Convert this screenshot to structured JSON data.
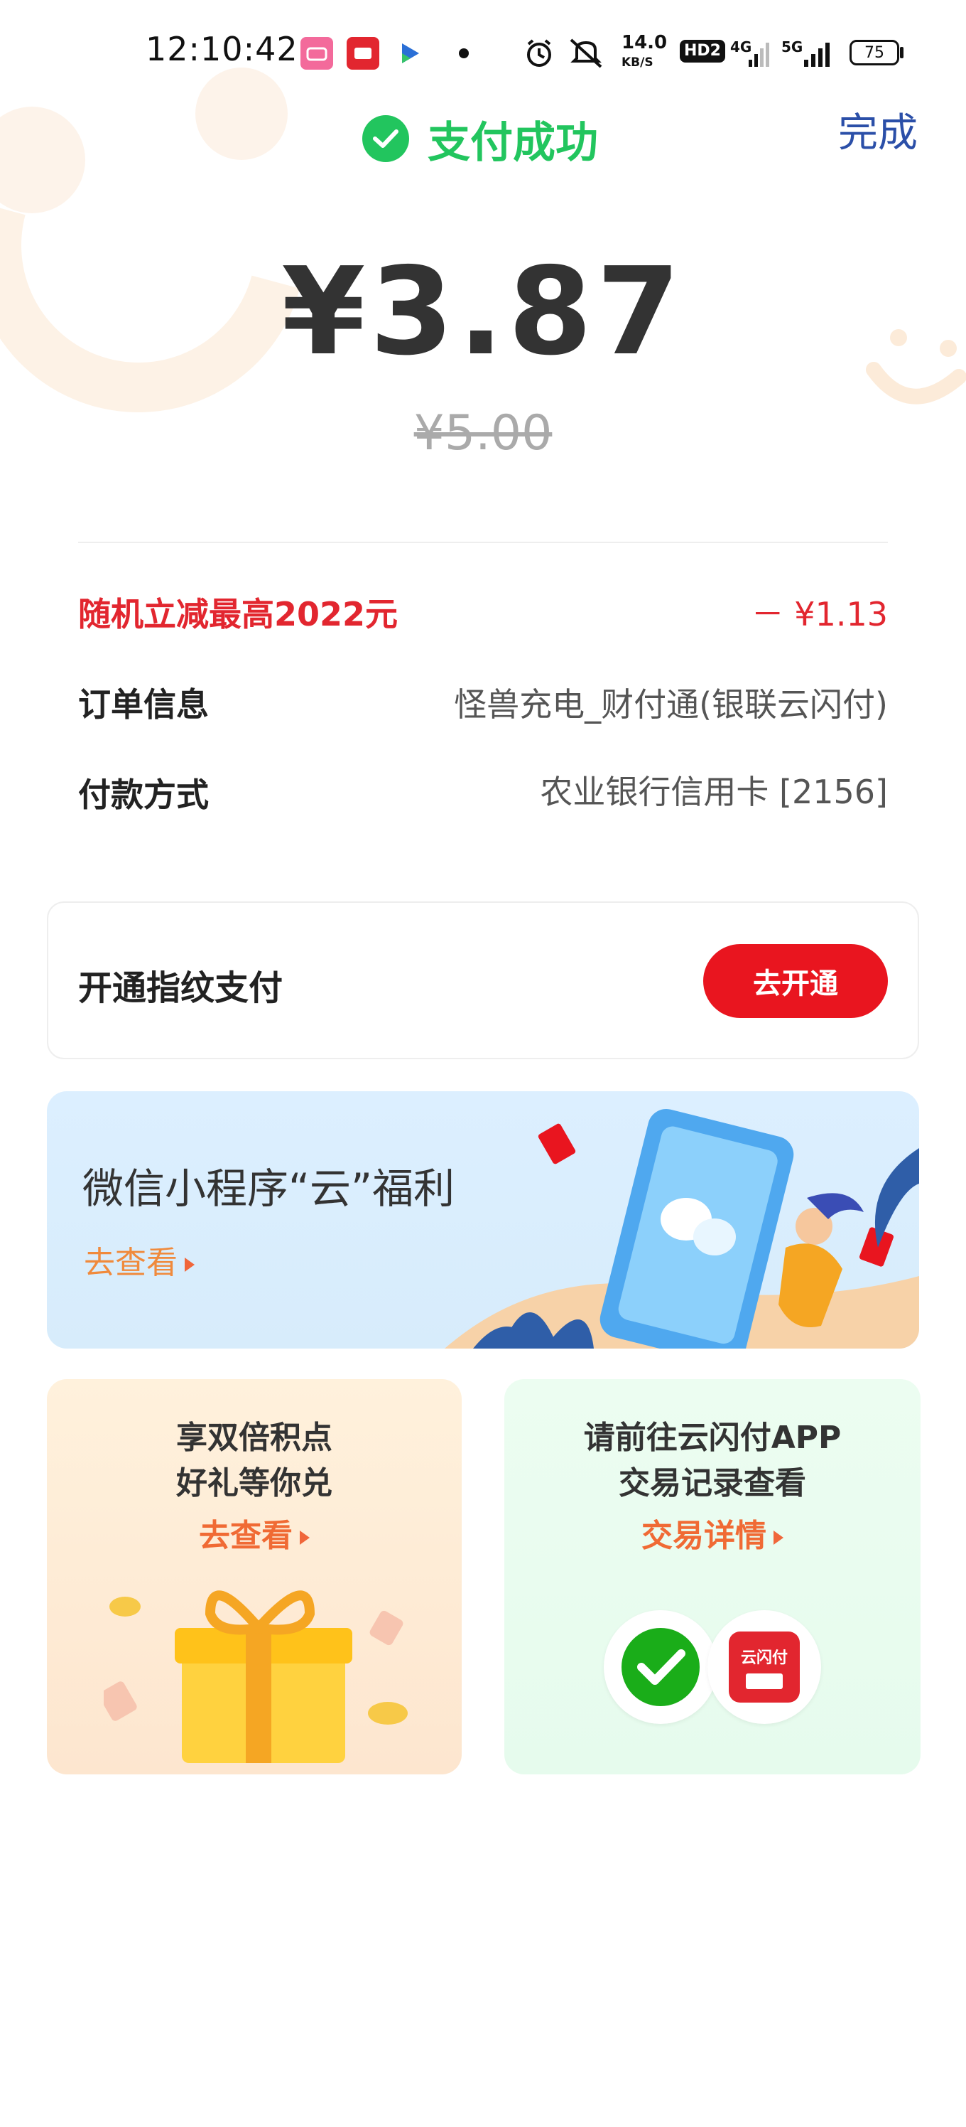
{
  "status_bar": {
    "time": "12:10:42",
    "speed": "14.0",
    "speed_unit": "KB/S",
    "hd": "HD2",
    "net1": "4G",
    "net2": "5G",
    "battery": "75",
    "apps": [
      {
        "icon": "bilibili-icon",
        "color": "#f36a9b"
      },
      {
        "icon": "unionpay-cloud-icon",
        "color": "#e2262f"
      },
      {
        "icon": "video-app-icon",
        "color": "#2a6fd6"
      }
    ]
  },
  "header": {
    "status": "支付成功",
    "done": "完成"
  },
  "payment": {
    "amount": "¥3.87",
    "original_amount": "¥5.00"
  },
  "details": [
    {
      "label": "随机立减最高2022元",
      "value": "－ ¥1.13",
      "highlight": true
    },
    {
      "label": "订单信息",
      "value": "怪兽充电_财付通(银联云闪付)"
    },
    {
      "label": "付款方式",
      "value": "农业银行信用卡 [2156]"
    }
  ],
  "fingerprint": {
    "label": "开通指纹支付",
    "button": "去开通"
  },
  "banner": {
    "title": "微信小程序“云”福利",
    "link": "去查看"
  },
  "cards": {
    "left": {
      "line1": "享双倍积点",
      "line2": "好礼等你兑",
      "link": "去查看"
    },
    "right": {
      "line1": "请前往云闪付APP",
      "line2": "交易记录查看",
      "link": "交易详情",
      "unionpay_logo_text": "云闪付"
    }
  },
  "colors": {
    "success_green": "#22c55e",
    "accent_red": "#e9151f",
    "link_blue": "#2b4fa8",
    "link_orange": "#f06a34"
  }
}
